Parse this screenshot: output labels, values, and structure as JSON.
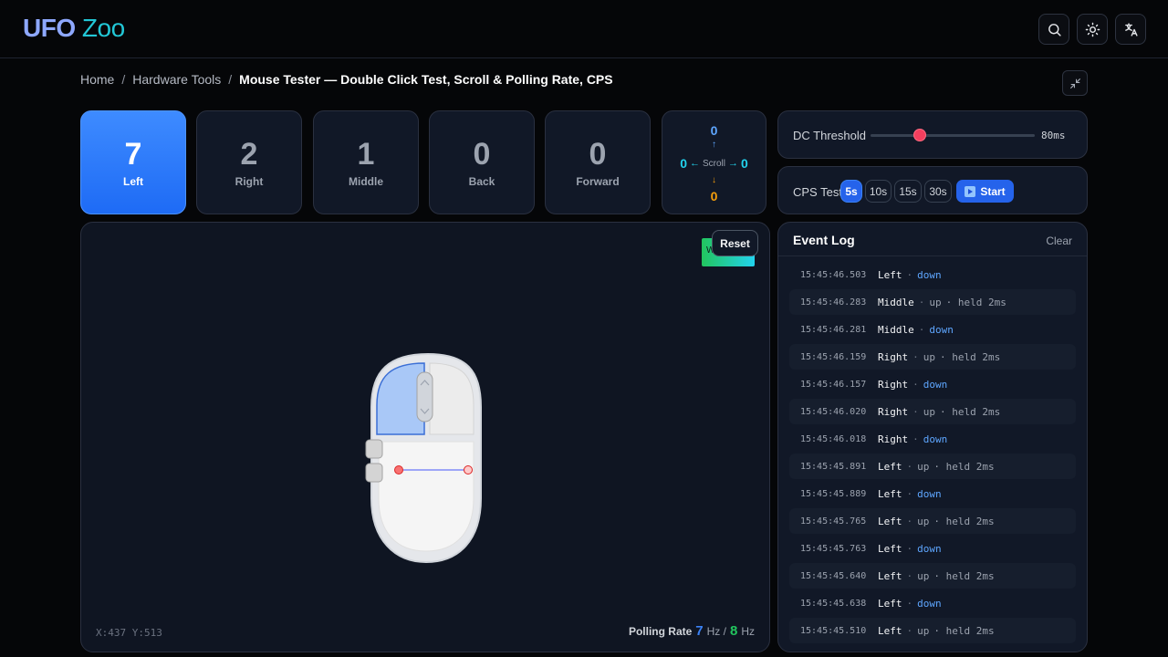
{
  "brand": {
    "part1": "UFO",
    "part2": "Zoo"
  },
  "header_icons": [
    "search-icon",
    "sun-icon",
    "translate-icon"
  ],
  "breadcrumb": {
    "items": [
      "Home",
      "Hardware Tools"
    ],
    "separator": "/",
    "current": "Mouse Tester — Double Click Test, Scroll & Polling Rate, CPS"
  },
  "counters": [
    {
      "label": "Left",
      "value": "7",
      "active": true
    },
    {
      "label": "Right",
      "value": "2",
      "active": false
    },
    {
      "label": "Middle",
      "value": "1",
      "active": false
    },
    {
      "label": "Back",
      "value": "0",
      "active": false
    },
    {
      "label": "Forward",
      "value": "0",
      "active": false
    }
  ],
  "scroll": {
    "up": "0",
    "down": "0",
    "left": "0",
    "right": "0",
    "label": "Scroll"
  },
  "dc_threshold": {
    "label": "DC Threshold",
    "value": "80ms",
    "level_fraction": 0.3
  },
  "cps_test": {
    "label": "CPS Test",
    "durations": [
      "5s",
      "10s",
      "15s",
      "30s"
    ],
    "selected": "5s",
    "start_label": "Start"
  },
  "test_area": {
    "badge_text": "W",
    "reset_label": "Reset",
    "coords": "X:437 Y:513",
    "polling_label": "Polling Rate",
    "polling_value_a": "7",
    "polling_unit_a": "Hz /",
    "polling_value_b": "8",
    "polling_unit_b": "Hz"
  },
  "event_log": {
    "title": "Event Log",
    "clear_label": "Clear",
    "entries": [
      {
        "time": "15:45:46.503",
        "button": "Left",
        "event": "down",
        "held": ""
      },
      {
        "time": "15:45:46.283",
        "button": "Middle",
        "event": "up",
        "held": "· held 2ms"
      },
      {
        "time": "15:45:46.281",
        "button": "Middle",
        "event": "down",
        "held": ""
      },
      {
        "time": "15:45:46.159",
        "button": "Right",
        "event": "up",
        "held": "· held 2ms"
      },
      {
        "time": "15:45:46.157",
        "button": "Right",
        "event": "down",
        "held": ""
      },
      {
        "time": "15:45:46.020",
        "button": "Right",
        "event": "up",
        "held": "· held 2ms"
      },
      {
        "time": "15:45:46.018",
        "button": "Right",
        "event": "down",
        "held": ""
      },
      {
        "time": "15:45:45.891",
        "button": "Left",
        "event": "up",
        "held": "· held 2ms"
      },
      {
        "time": "15:45:45.889",
        "button": "Left",
        "event": "down",
        "held": ""
      },
      {
        "time": "15:45:45.765",
        "button": "Left",
        "event": "up",
        "held": "· held 2ms"
      },
      {
        "time": "15:45:45.763",
        "button": "Left",
        "event": "down",
        "held": ""
      },
      {
        "time": "15:45:45.640",
        "button": "Left",
        "event": "up",
        "held": "· held 2ms"
      },
      {
        "time": "15:45:45.638",
        "button": "Left",
        "event": "down",
        "held": ""
      },
      {
        "time": "15:45:45.510",
        "button": "Left",
        "event": "up",
        "held": "· held 2ms"
      }
    ]
  },
  "colors": {
    "accent": "#2563eb",
    "active_card": "#3e8bff",
    "scroll_vertical": "#5ea6ff",
    "scroll_horizontal": "#22d3ee",
    "scroll_down": "#f59e0b",
    "slider_thumb": "#f43f5e",
    "polling_a": "#3b82f6",
    "polling_b": "#22c55e"
  }
}
